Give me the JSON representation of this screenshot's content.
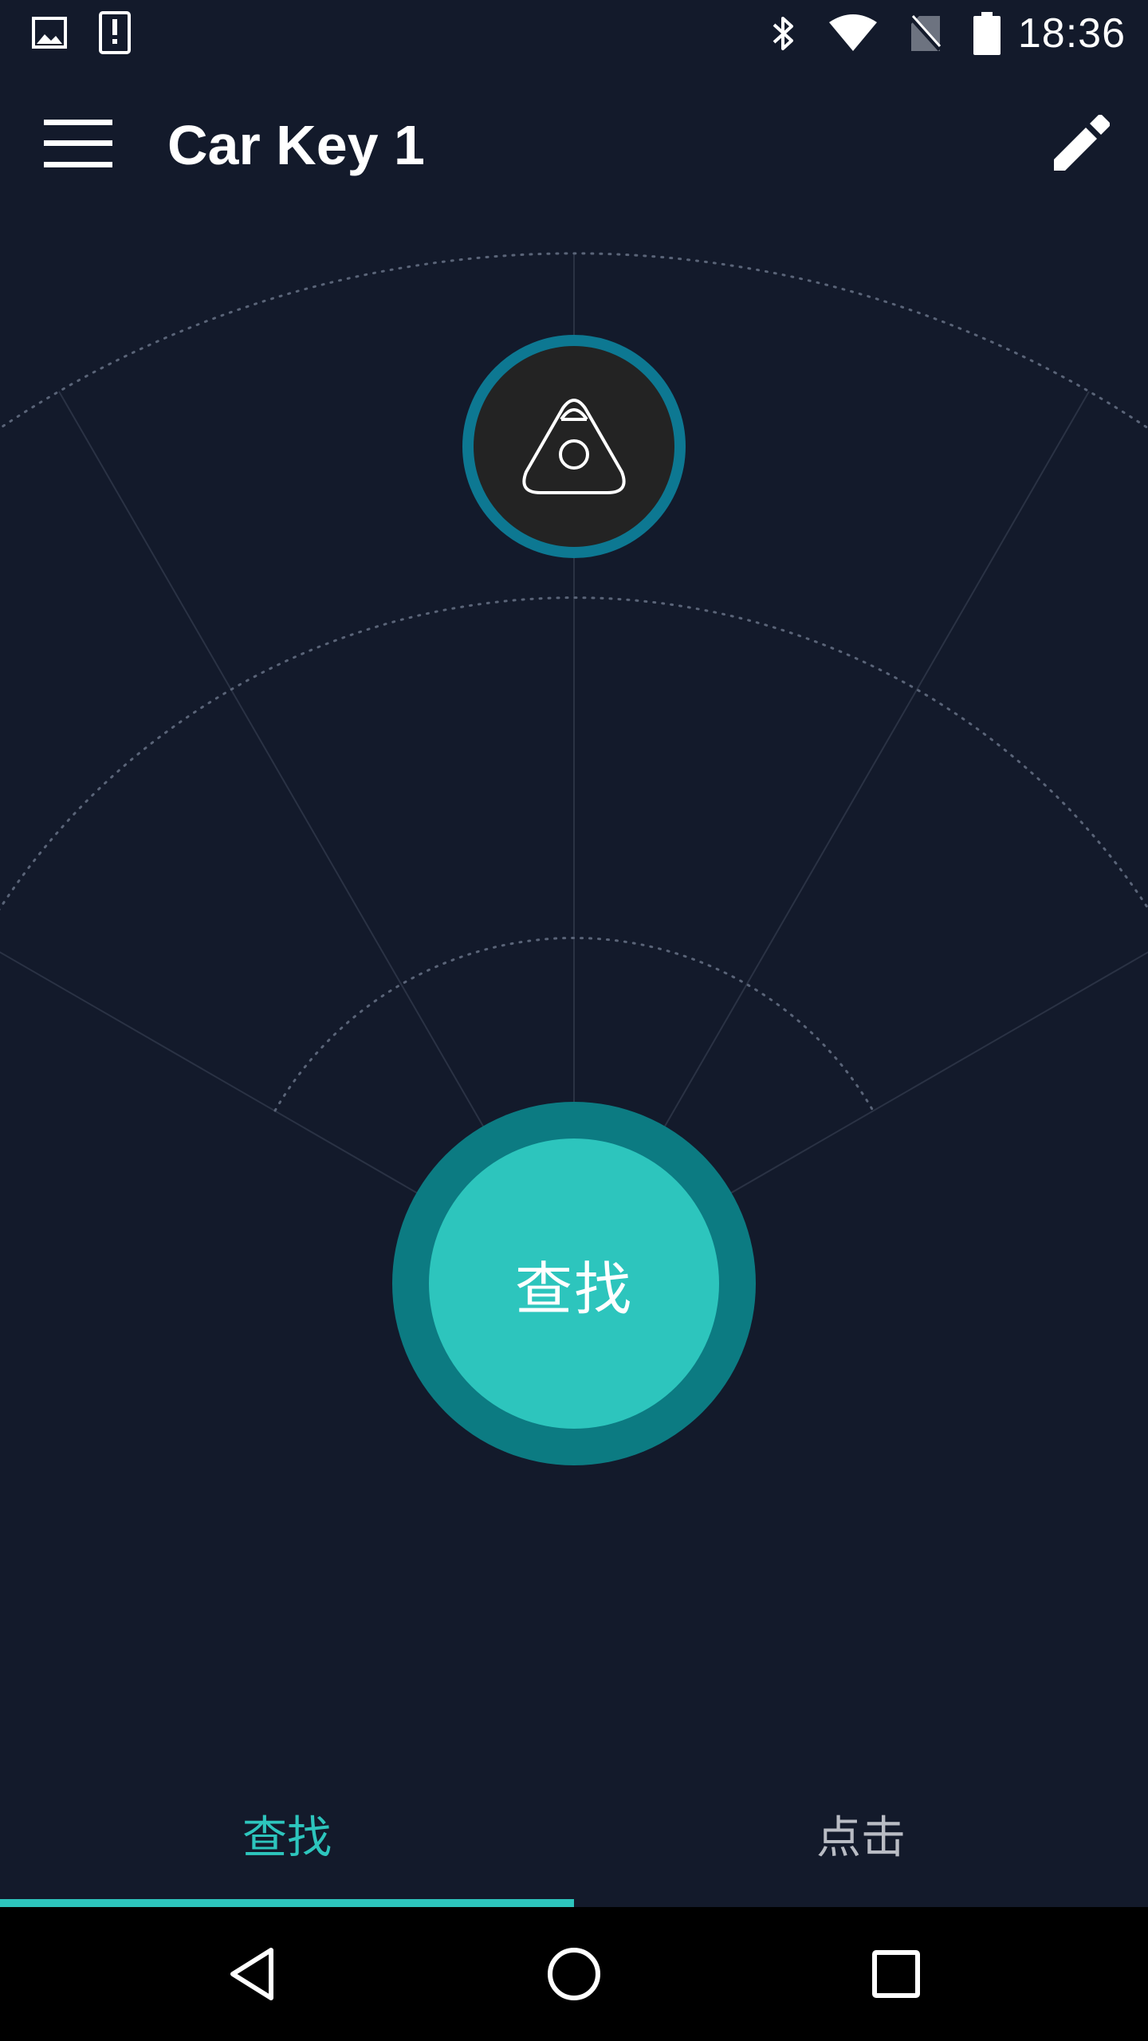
{
  "status_bar": {
    "time": "18:36",
    "left_icons": [
      "image-notification-icon",
      "alert-notification-icon"
    ],
    "right_icons": [
      "bluetooth-icon",
      "wifi-icon",
      "no-sim-icon",
      "battery-icon"
    ]
  },
  "app_bar": {
    "title": "Car Key 1",
    "menu_icon": "hamburger-menu-icon",
    "edit_icon": "pencil-icon"
  },
  "radar": {
    "device_icon": "triangle-tag-icon",
    "find_button_label": "查找"
  },
  "tabs": [
    {
      "label": "查找",
      "selected": true
    },
    {
      "label": "点击",
      "selected": false
    }
  ],
  "nav_bar": {
    "icons": [
      "back-icon",
      "home-icon",
      "recent-apps-icon"
    ]
  },
  "colors": {
    "background": "#131a2b",
    "accent": "#2dc5bd",
    "accent_dark": "#0c7b82",
    "device_ring": "#0d7892",
    "tab_inactive": "#b9bcc4"
  }
}
